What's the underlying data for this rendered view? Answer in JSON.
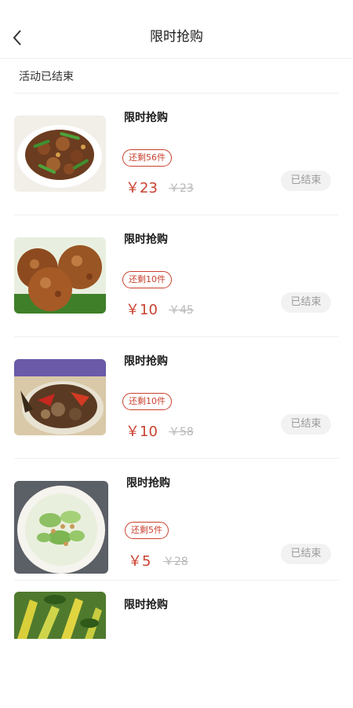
{
  "header": {
    "title": "限时抢购"
  },
  "status": {
    "text": "活动已结束"
  },
  "items": [
    {
      "title": "限时抢购",
      "stock": "还剩56件",
      "price": "￥23",
      "original_price": "￥23",
      "button": "已结束",
      "image": "braised-pork-with-peppers"
    },
    {
      "title": "限时抢购",
      "stock": "还剩10件",
      "price": "￥10",
      "original_price": "￥45",
      "button": "已结束",
      "image": "braised-meatballs"
    },
    {
      "title": "限时抢购",
      "stock": "还剩10件",
      "price": "￥10",
      "original_price": "￥58",
      "button": "已结束",
      "image": "mushroom-pepper-stir-fry"
    },
    {
      "title": "限时抢购",
      "stock": "还剩5件",
      "price": "￥5",
      "original_price": "￥28",
      "button": "已结束",
      "image": "cucumber-peanut-salad"
    },
    {
      "title": "限时抢购",
      "image": "zucchini-stir-fry"
    }
  ],
  "colors": {
    "accent": "#c9412f",
    "muted": "#b8b8b8",
    "button_bg": "#f2f2f2"
  }
}
